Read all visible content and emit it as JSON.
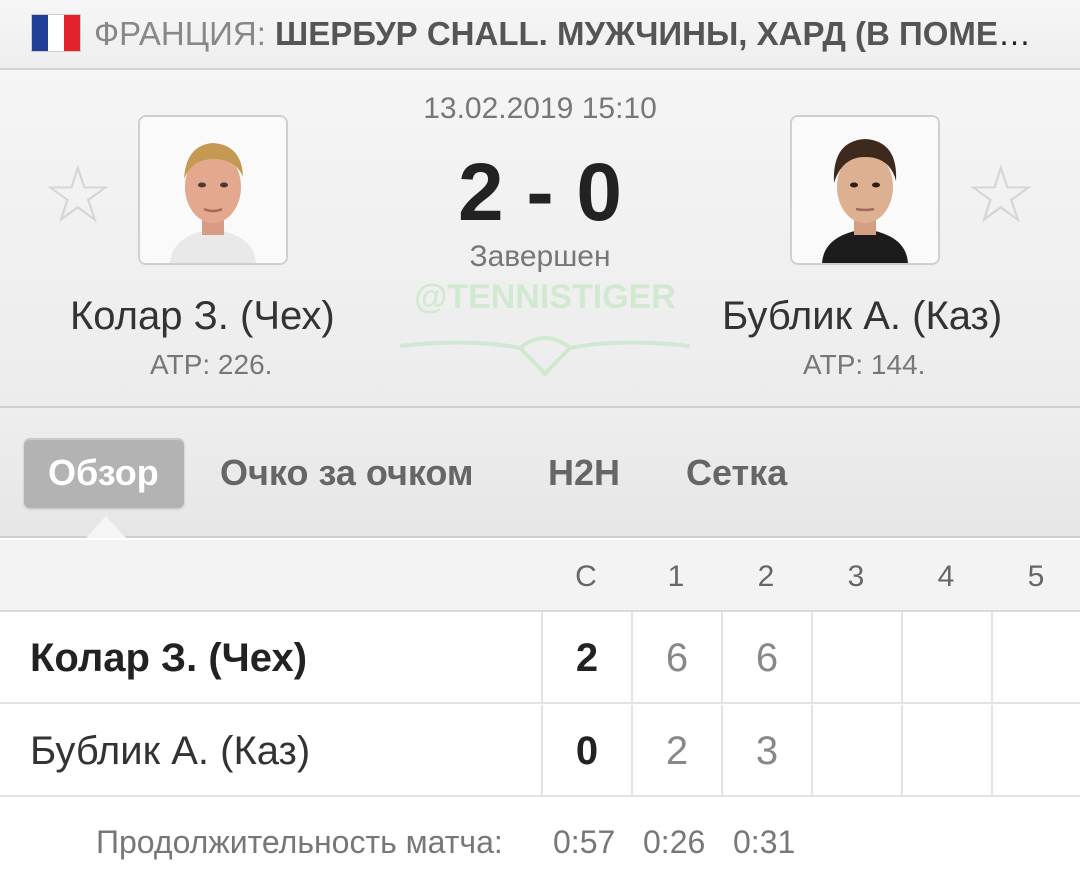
{
  "header": {
    "country": "ФРАНЦИЯ: ",
    "tournament": "ШЕРБУР CHALL. МУЖЧИНЫ, ХАРД (В ПОМЕЩ...",
    "flag_colors": [
      "#1f3f99",
      "#ffffff",
      "#e2232b"
    ]
  },
  "match": {
    "datetime": "13.02.2019 15:10",
    "score": "2 - 0",
    "status": "Завершен",
    "watermark": "@TENNISTIGER",
    "home": {
      "name": "Колар З. (Чех)",
      "rank": "ATP: 226.",
      "star_icon": "star-outline-icon"
    },
    "away": {
      "name": "Бублик А. (Каз)",
      "rank": "ATP: 144.",
      "star_icon": "star-outline-icon"
    }
  },
  "tabs": [
    {
      "label": "Обзор",
      "active": true
    },
    {
      "label": "Очко за очком",
      "active": false
    },
    {
      "label": "H2H",
      "active": false
    },
    {
      "label": "Сетка",
      "active": false
    }
  ],
  "table": {
    "columns": [
      "С",
      "1",
      "2",
      "3",
      "4",
      "5"
    ],
    "rows": [
      {
        "player": "Колар З. (Чех)",
        "total": "2",
        "sets": [
          "6",
          "6",
          "",
          "",
          ""
        ]
      },
      {
        "player": "Бублик А. (Каз)",
        "total": "0",
        "sets": [
          "2",
          "3",
          "",
          "",
          ""
        ]
      }
    ]
  },
  "duration": {
    "label": "Продолжительность матча:",
    "total": "0:57",
    "sets": [
      "0:26",
      "0:31"
    ]
  }
}
